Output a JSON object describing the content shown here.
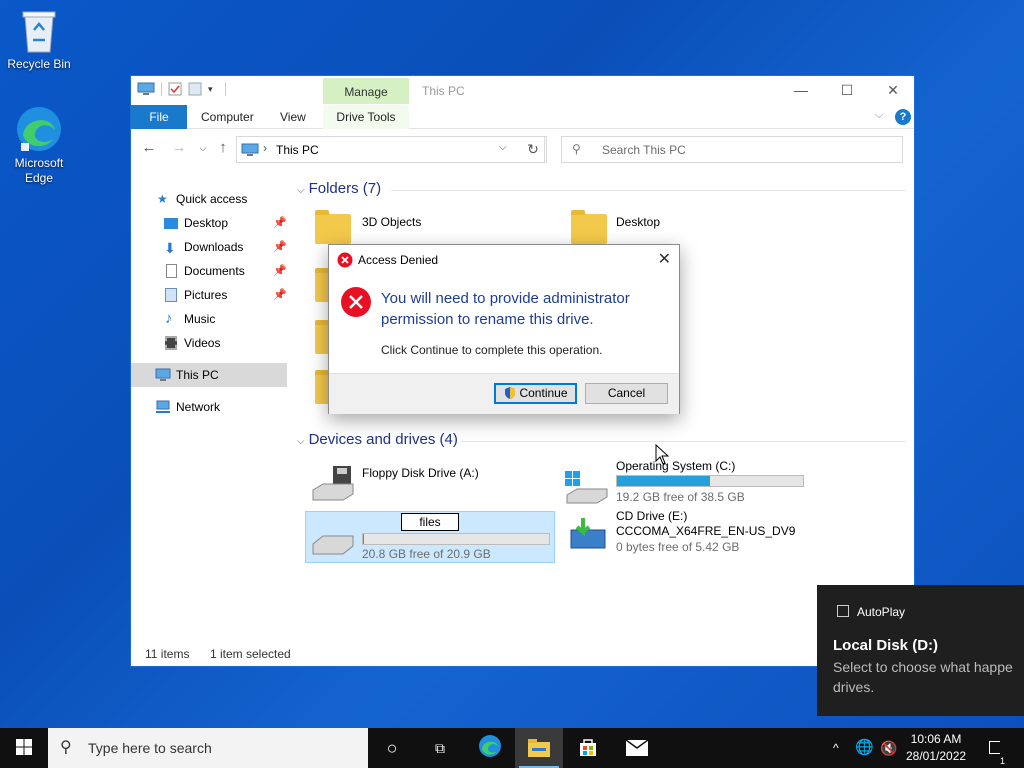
{
  "desktop": {
    "icons": [
      {
        "label": "Recycle Bin"
      },
      {
        "label": "Microsoft Edge"
      }
    ]
  },
  "explorer": {
    "window_title": "This PC",
    "contextual_tab": "Manage",
    "ribbon_tabs": [
      "File",
      "Computer",
      "View",
      "Drive Tools"
    ],
    "address": "This PC",
    "search_placeholder": "Search This PC",
    "nav": {
      "quick_access": "Quick access",
      "items": [
        "Desktop",
        "Downloads",
        "Documents",
        "Pictures",
        "Music",
        "Videos"
      ],
      "this_pc": "This PC",
      "network": "Network"
    },
    "folders_header": "Folders (7)",
    "folders": [
      "3D Objects",
      "Desktop"
    ],
    "devices_header": "Devices and drives (4)",
    "drives": {
      "floppy": {
        "name": "Floppy Disk Drive (A:)"
      },
      "c": {
        "name": "Operating System (C:)",
        "free": "19.2 GB free of 38.5 GB",
        "used_fraction": 0.5
      },
      "d": {
        "rename_value": "files",
        "free": "20.8 GB free of 20.9 GB",
        "used_fraction": 0.005
      },
      "e": {
        "name": "CD Drive (E:)",
        "label": "CCCOMA_X64FRE_EN-US_DV9",
        "free": "0 bytes free of 5.42 GB"
      }
    },
    "status": {
      "items": "11 items",
      "selected": "1 item selected"
    }
  },
  "dialog": {
    "title": "Access Denied",
    "main": "You will need to provide administrator permission to rename this drive.",
    "sub": "Click Continue to complete this operation.",
    "continue": "Continue",
    "cancel": "Cancel"
  },
  "toast": {
    "app": "AutoPlay",
    "title": "Local Disk (D:)",
    "body": "Select to choose what happe drives."
  },
  "taskbar": {
    "search_placeholder": "Type here to search",
    "time": "10:06 AM",
    "date": "28/01/2022",
    "notifications": "1"
  },
  "colors": {
    "accent": "#0078d7",
    "dialog_text": "#1e3f91",
    "selected_drive_bg": "#cce8ff"
  }
}
